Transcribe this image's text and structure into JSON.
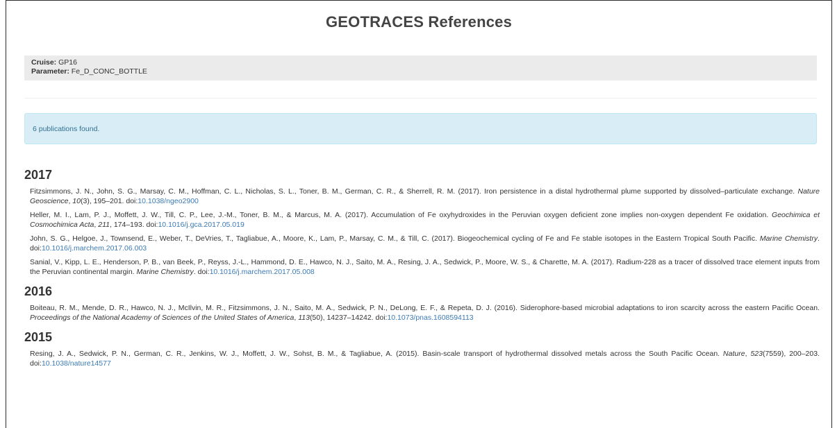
{
  "page": {
    "title": "GEOTRACES References"
  },
  "meta": {
    "cruise_label": "Cruise:",
    "cruise_value": "GP16",
    "parameter_label": "Parameter:",
    "parameter_value": "Fe_D_CONC_BOTTLE"
  },
  "alert": {
    "text": "6 publications found."
  },
  "colors": {
    "link": "#3b7ab5",
    "alert_bg": "#d9edf7",
    "alert_text": "#31708f",
    "meta_bg": "#ebebeb"
  },
  "sections": [
    {
      "year": "2017",
      "refs": [
        {
          "authors": "Fitzsimmons, J. N., John, S. G., Marsay, C. M., Hoffman, C. L., Nicholas, S. L., Toner, B. M., German, C. R., & Sherrell, R. M. (2017). Iron persistence in a distal hydrothermal plume supported by dissolved–particulate exchange. ",
          "journal": "Nature Geoscience",
          "sep1": ", ",
          "volume": "10",
          "rest": "(3), 195–201. doi:",
          "doi": "10.1038/ngeo2900"
        },
        {
          "authors": "Heller, M. I., Lam, P. J., Moffett, J. W., Till, C. P., Lee, J.-M., Toner, B. M., & Marcus, M. A. (2017). Accumulation of Fe oxyhydroxides in the Peruvian oxygen deficient zone implies non-oxygen dependent Fe oxidation. ",
          "journal": "Geochimica et Cosmochimica Acta",
          "sep1": ", ",
          "volume": "211",
          "rest": ", 174–193. doi:",
          "doi": "10.1016/j.gca.2017.05.019"
        },
        {
          "authors": "John, S. G., Helgoe, J., Townsend, E., Weber, T., DeVries, T., Tagliabue, A., Moore, K., Lam, P., Marsay, C. M., & Till, C. (2017). Biogeochemical cycling of Fe and Fe stable isotopes in the Eastern Tropical South Pacific. ",
          "journal": "Marine Chemistry",
          "sep1": ". doi:",
          "volume": "",
          "rest": "",
          "doi": "10.1016/j.marchem.2017.06.003"
        },
        {
          "authors": "Sanial, V., Kipp, L. E., Henderson, P. B., van Beek, P., Reyss, J.-L., Hammond, D. E., Hawco, N. J., Saito, M. A., Resing, J. A., Sedwick, P., Moore, W. S., & Charette, M. A. (2017). Radium-228 as a tracer of dissolved trace element inputs from the Peruvian continental margin. ",
          "journal": "Marine Chemistry",
          "sep1": ". doi:",
          "volume": "",
          "rest": "",
          "doi": "10.1016/j.marchem.2017.05.008"
        }
      ]
    },
    {
      "year": "2016",
      "refs": [
        {
          "authors": "Boiteau, R. M., Mende, D. R., Hawco, N. J., McIlvin, M. R., Fitzsimmons, J. N., Saito, M. A., Sedwick, P. N., DeLong, E. F., & Repeta, D. J. (2016). Siderophore-based microbial adaptations to iron scarcity across the eastern Pacific Ocean. ",
          "journal": "Proceedings of the National Academy of Sciences of the United States of America",
          "sep1": ", ",
          "volume": "113",
          "rest": "(50), 14237–14242. doi:",
          "doi": "10.1073/pnas.1608594113"
        }
      ]
    },
    {
      "year": "2015",
      "refs": [
        {
          "authors": "Resing, J. A., Sedwick, P. N., German, C. R., Jenkins, W. J., Moffett, J. W., Sohst, B. M., & Tagliabue, A. (2015). Basin-scale transport of hydrothermal dissolved metals across the South Pacific Ocean. ",
          "journal": "Nature",
          "sep1": ", ",
          "volume": "523",
          "rest": "(7559), 200–203. doi:",
          "doi": "10.1038/nature14577"
        }
      ]
    }
  ]
}
